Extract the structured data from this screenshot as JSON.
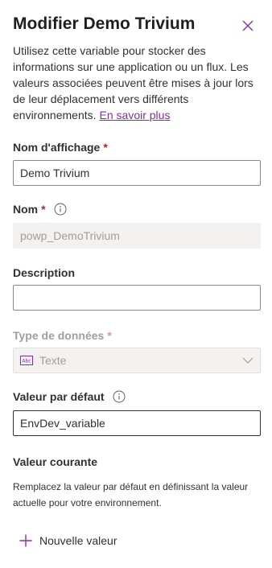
{
  "panel": {
    "title": "Modifier Demo Trivium",
    "description": "Utilisez cette variable pour stocker des informations sur une application ou un flux. Les valeurs associées peuvent être mises à jour lors de leur déplacement vers différents environnements.",
    "learn_more": "En savoir plus"
  },
  "display_name": {
    "label": "Nom d'affichage",
    "required": "*",
    "value": "Demo Trivium"
  },
  "name": {
    "label": "Nom",
    "required": "*",
    "value": "powp_DemoTrivium"
  },
  "description_field": {
    "label": "Description",
    "value": ""
  },
  "data_type": {
    "label": "Type de données",
    "required": "*",
    "value": "Texte"
  },
  "default_value": {
    "label": "Valeur par défaut",
    "value": "EnvDev_variable"
  },
  "current_value": {
    "label": "Valeur courante",
    "helper": "Remplacez la valeur par défaut en définissant la valeur actuelle pour votre environnement.",
    "add_label": "Nouvelle valeur"
  },
  "colors": {
    "accent": "#8a2da5",
    "required": "#a4262c",
    "disabled_bg": "#f3f2f1",
    "disabled_text": "#a19f9d"
  }
}
